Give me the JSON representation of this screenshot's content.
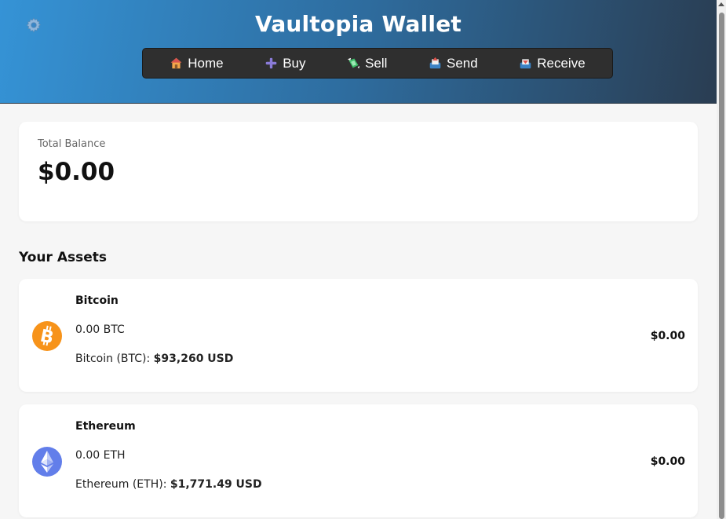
{
  "app": {
    "title": "Vaultopia Wallet",
    "settings_icon": "gear-icon"
  },
  "nav": {
    "items": [
      {
        "label": "Home",
        "icon": "house-icon"
      },
      {
        "label": "Buy",
        "icon": "plus-icon"
      },
      {
        "label": "Sell",
        "icon": "money-wings-icon"
      },
      {
        "label": "Send",
        "icon": "outbox-tray-icon"
      },
      {
        "label": "Receive",
        "icon": "inbox-tray-icon"
      }
    ]
  },
  "balance": {
    "label": "Total Balance",
    "value": "$0.00"
  },
  "assets": {
    "heading": "Your Assets",
    "items": [
      {
        "name": "Bitcoin",
        "amount": "0.00 BTC",
        "price_label": "Bitcoin (BTC): ",
        "price_value": "$93,260 USD",
        "value": "$0.00",
        "icon": "bitcoin-icon",
        "color": "#f7931a"
      },
      {
        "name": "Ethereum",
        "amount": "0.00 ETH",
        "price_label": "Ethereum (ETH): ",
        "price_value": "$1,771.49 USD",
        "value": "$0.00",
        "icon": "ethereum-icon",
        "color": "#627eea"
      }
    ]
  },
  "colors": {
    "header_start": "#3593d6",
    "header_end": "#2a3d52",
    "nav_bg": "#2f2f2f",
    "page_bg": "#f6f6f6"
  }
}
